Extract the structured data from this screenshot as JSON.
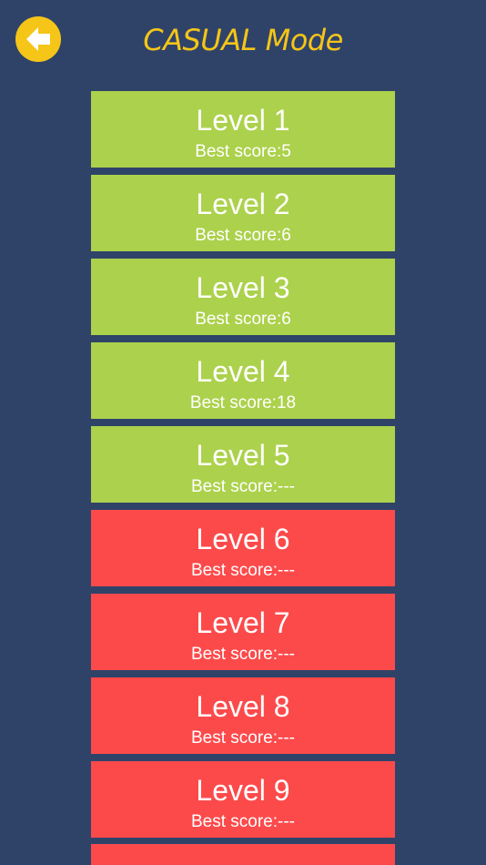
{
  "header": {
    "title": "CASUAL Mode",
    "back_icon": "arrow-left-icon"
  },
  "colors": {
    "background": "#2f4369",
    "accent": "#f5c518",
    "unlocked": "#acd14c",
    "locked": "#fc4a4b"
  },
  "levels": [
    {
      "name": "Level 1",
      "score": "Best score:5",
      "status": "unlocked"
    },
    {
      "name": "Level 2",
      "score": "Best score:6",
      "status": "unlocked"
    },
    {
      "name": "Level 3",
      "score": "Best score:6",
      "status": "unlocked"
    },
    {
      "name": "Level 4",
      "score": "Best score:18",
      "status": "unlocked"
    },
    {
      "name": "Level 5",
      "score": "Best score:---",
      "status": "unlocked"
    },
    {
      "name": "Level 6",
      "score": "Best score:---",
      "status": "locked"
    },
    {
      "name": "Level 7",
      "score": "Best score:---",
      "status": "locked"
    },
    {
      "name": "Level 8",
      "score": "Best score:---",
      "status": "locked"
    },
    {
      "name": "Level 9",
      "score": "Best score:---",
      "status": "locked"
    }
  ]
}
